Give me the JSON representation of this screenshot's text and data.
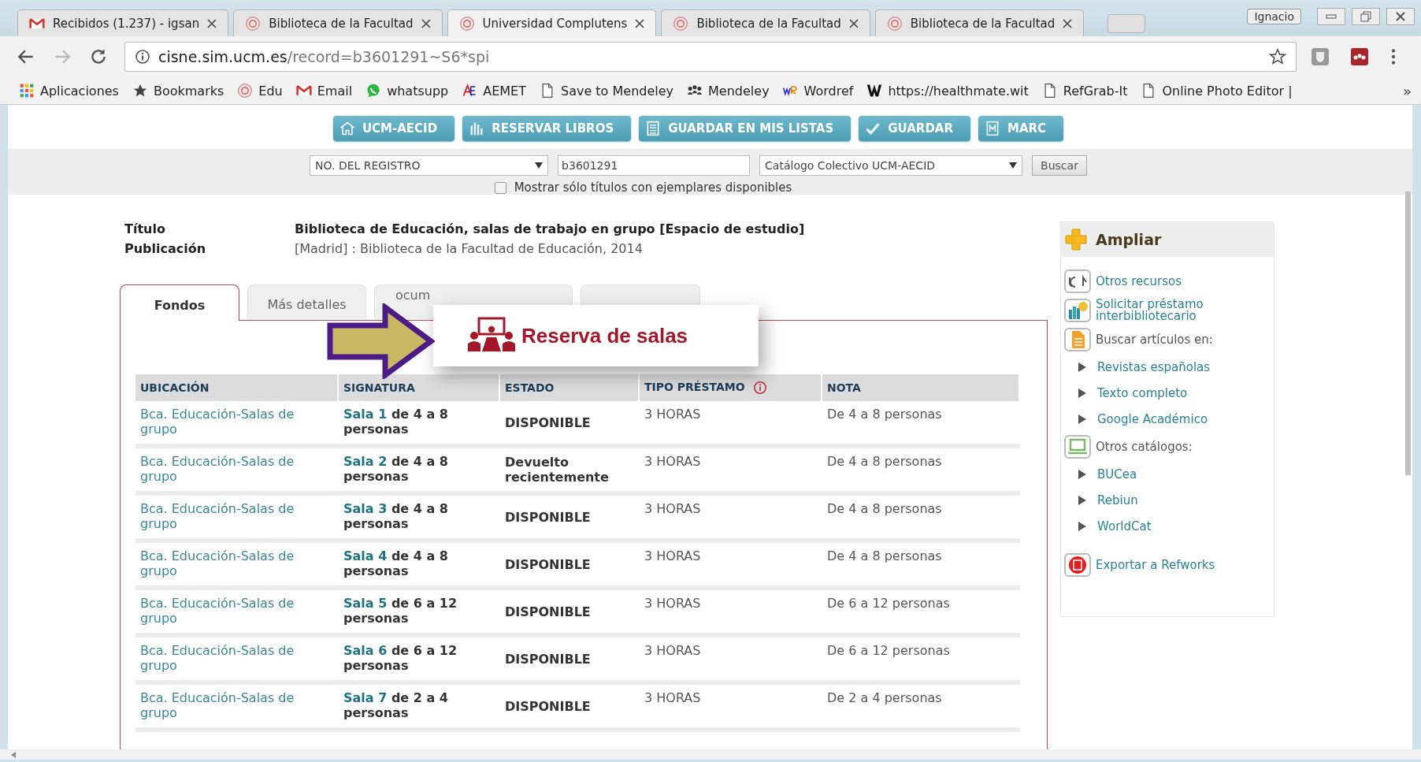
{
  "browser": {
    "tabs": [
      {
        "title": "Recibidos (1.237) - igsan",
        "selected": false
      },
      {
        "title": "Biblioteca de la Facultad",
        "selected": false
      },
      {
        "title": "Universidad Complutens",
        "selected": true
      },
      {
        "title": "Biblioteca de la Facultad",
        "selected": false
      },
      {
        "title": "Biblioteca de la Facultad",
        "selected": false
      }
    ],
    "profile": "Ignacio",
    "address": {
      "host": "cisne.sim.ucm.es",
      "path": "/record=b3601291~S6*spi"
    },
    "bookmarks": [
      {
        "label": "Aplicaciones"
      },
      {
        "label": "Bookmarks"
      },
      {
        "label": "Edu"
      },
      {
        "label": "Email"
      },
      {
        "label": "whatsupp"
      },
      {
        "label": "AEMET"
      },
      {
        "label": "Save to Mendeley"
      },
      {
        "label": "Mendeley"
      },
      {
        "label": "Wordref"
      },
      {
        "label": "https://healthmate.wit"
      },
      {
        "label": "RefGrab-It"
      },
      {
        "label": "Online Photo Editor | "
      }
    ],
    "more": "»"
  },
  "toolbar_buttons": [
    "UCM-AECID",
    "RESERVAR LIBROS",
    "GUARDAR EN MIS LISTAS",
    "GUARDAR",
    "MARC"
  ],
  "search": {
    "field": "NO. DEL REGISTRO",
    "value": "b3601291",
    "catalog": "Catálogo Colectivo UCM-AECID",
    "button": "Buscar",
    "filter": {
      "label": "Mostrar sólo títulos con ejemplares disponibles",
      "checked": false
    }
  },
  "record": [
    {
      "label": "Título",
      "value": "Biblioteca de Educación, salas de trabajo en grupo [Espacio de estudio]"
    },
    {
      "label": "Publicación",
      "value": "[Madrid] : Biblioteca de la Facultad de Educación, 2014"
    }
  ],
  "record_tabs": [
    {
      "label": "Fondos",
      "selected": true
    },
    {
      "label": "Más detalles",
      "selected": false
    },
    {
      "label": "ocum",
      "selected": false
    },
    {
      "selected": false
    }
  ],
  "callout": {
    "text": "Reserva de salas"
  },
  "table": {
    "columns": [
      "UBICACIÓN",
      "SIGNATURA",
      "ESTADO",
      "TIPO PRÉSTAMO",
      "NOTA"
    ],
    "rows": [
      {
        "location": "Bca. Educación-Salas de grupo",
        "room": "Sala 1",
        "capacity": "de 4 a 8 personas",
        "status": "DISPONIBLE",
        "loan": "3 HORAS",
        "note": "De 4 a 8 personas"
      },
      {
        "location": "Bca. Educación-Salas de grupo",
        "room": "Sala 2",
        "capacity": "de 4 a 8 personas",
        "status": "Devuelto recientemente",
        "loan": "3 HORAS",
        "note": "De 4 a 8 personas"
      },
      {
        "location": "Bca. Educación-Salas de grupo",
        "room": "Sala 3",
        "capacity": "de 4 a 8 personas",
        "status": "DISPONIBLE",
        "loan": "3 HORAS",
        "note": "De 4 a 8 personas"
      },
      {
        "location": "Bca. Educación-Salas de grupo",
        "room": "Sala 4",
        "capacity": "de 4 a 8 personas",
        "status": "DISPONIBLE",
        "loan": "3 HORAS",
        "note": "De 4 a 8 personas"
      },
      {
        "location": "Bca. Educación-Salas de grupo",
        "room": "Sala 5",
        "capacity": "de 6 a 12 personas",
        "status": "DISPONIBLE",
        "loan": "3 HORAS",
        "note": "De 6 a 12 personas"
      },
      {
        "location": "Bca. Educación-Salas de grupo",
        "room": "Sala 6",
        "capacity": "de 6 a 12 personas",
        "status": "DISPONIBLE",
        "loan": "3 HORAS",
        "note": "De 6 a 12 personas"
      },
      {
        "location": "Bca. Educación-Salas de grupo",
        "room": "Sala 7",
        "capacity": "de 2 a 4 personas",
        "status": "DISPONIBLE",
        "loan": "3 HORAS",
        "note": "De 2 a 4 personas"
      }
    ]
  },
  "sidebar": {
    "title": "Ampliar",
    "items": [
      {
        "kind": "link",
        "label": "Otros recursos"
      },
      {
        "kind": "link",
        "label": "Solicitar préstamo interbibliotecario"
      },
      {
        "kind": "heading",
        "label": "Buscar artículos en:"
      },
      {
        "kind": "sublink",
        "label": "Revistas españolas"
      },
      {
        "kind": "sublink",
        "label": "Texto completo"
      },
      {
        "kind": "sublink",
        "label": "Google Académico"
      },
      {
        "kind": "heading",
        "label": "Otros catálogos:"
      },
      {
        "kind": "sublink",
        "label": "BUCea"
      },
      {
        "kind": "sublink",
        "label": "Rebiun"
      },
      {
        "kind": "sublink",
        "label": "WorldCat"
      },
      {
        "kind": "link",
        "label": "Exportar a Refworks"
      }
    ]
  }
}
